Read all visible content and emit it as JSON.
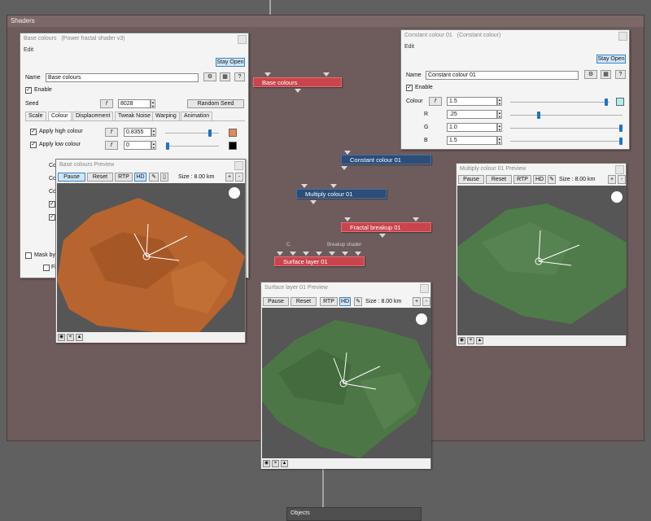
{
  "shaders_panel": {
    "title": "Shaders"
  },
  "base_colours_window": {
    "title": "Base colours",
    "subtitle": "(Power fractal shader v3)",
    "menu_edit": "Edit",
    "stay_open": "Stay Open",
    "name_label": "Name",
    "name_value": "Base colours",
    "enable_label": "Enable",
    "seed_label": "Seed",
    "seed_value": "8028",
    "random_seed": "Random Seed",
    "tabs": [
      "Scale",
      "Colour",
      "Displacement",
      "Tweak Noise",
      "Warping",
      "Animation"
    ],
    "apply_high_label": "Apply high colour",
    "apply_high_value": "0.8355",
    "apply_high_color": "#e08a5a",
    "apply_low_label": "Apply low colour",
    "apply_low_value": "0",
    "apply_low_color": "#000000",
    "partial_labels": [
      "Col",
      "Col",
      "Col"
    ],
    "mask_label": "Mask by s",
    "fit_label": "Fit"
  },
  "constant_colour_window": {
    "title": "Constant colour 01",
    "subtitle": "(Constant colour)",
    "menu_edit": "Edit",
    "stay_open": "Stay Open",
    "name_label": "Name",
    "name_value": "Constant colour 01",
    "enable_label": "Enable",
    "colour_label": "Colour",
    "colour_value": "1.5",
    "colour_swatch": "#aaeef0",
    "r_label": "R",
    "r_value": ".25",
    "g_label": "G",
    "g_value": "1.0",
    "b_label": "B",
    "b_value": "1.5"
  },
  "nodes": {
    "base_colours": "Base colours",
    "constant_colour": "Constant colour 01",
    "multiply_colour": "Multiply colour 01",
    "fractal_breakup": "Fractal breakup 01",
    "surface_layer": "Surface layer 01",
    "label_c": "C.",
    "label_breakup": "Breakup shader"
  },
  "preview_base": {
    "title": "Base colours Preview",
    "pause": "Pause",
    "reset": "Reset",
    "rtp": "RTP",
    "hd": "HD",
    "size": "Size : 8.00 km",
    "plus": "+",
    "minus": "-"
  },
  "preview_multiply": {
    "title": "Multiply colour 01 Preview",
    "pause": "Pause",
    "reset": "Reset",
    "rtp": "RTP",
    "hd": "HD",
    "size": "Size : 8.00 km",
    "plus": "+",
    "minus": "-"
  },
  "preview_surface": {
    "title": "Surface layer 01 Preview",
    "pause": "Pause",
    "reset": "Reset",
    "rtp": "RTP",
    "hd": "HD",
    "size": "Size : 8.00 km",
    "plus": "+",
    "minus": "-"
  },
  "objects_panel": {
    "title": "Objects"
  },
  "colors": {
    "red_node": "#c9444c",
    "blue_node": "#2a4d7a",
    "terrain_orange": "#b8642e",
    "terrain_green": "#4f7a4a"
  }
}
